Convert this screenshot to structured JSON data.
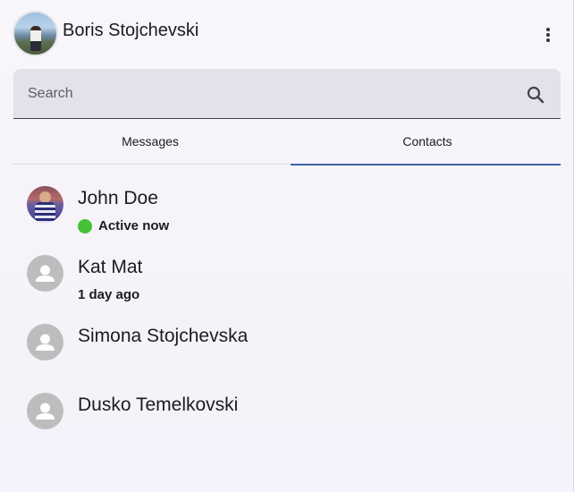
{
  "header": {
    "user_name": "Boris Stojchevski",
    "menu_icon": "more-vert-icon"
  },
  "search": {
    "placeholder": "Search",
    "value": "",
    "icon": "search-icon"
  },
  "tabs": [
    {
      "label": "Messages",
      "active": false
    },
    {
      "label": "Contacts",
      "active": true
    }
  ],
  "colors": {
    "accent": "#3f5fa8",
    "online": "#44c236",
    "placeholder_avatar": "#bdbdbd"
  },
  "contacts": [
    {
      "name": "John Doe",
      "status": "Active now",
      "online": true,
      "avatar": "photo"
    },
    {
      "name": "Kat Mat",
      "status": "1 day ago",
      "online": false,
      "avatar": "default"
    },
    {
      "name": "Simona Stojchevska",
      "status": "",
      "online": false,
      "avatar": "default"
    },
    {
      "name": "Dusko Temelkovski",
      "status": "",
      "online": false,
      "avatar": "default"
    }
  ]
}
